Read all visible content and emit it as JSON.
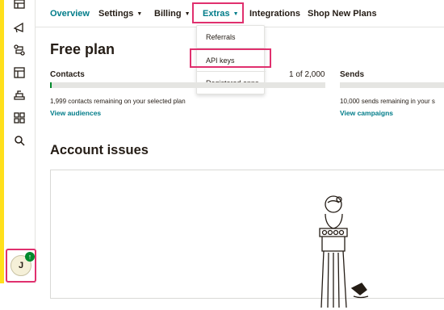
{
  "sidebar": {
    "icons": [
      "campaigns-icon",
      "megaphone-icon",
      "automations-icon",
      "website-icon",
      "content-icon",
      "integrations-icon",
      "search-icon"
    ],
    "avatar": {
      "initial": "J",
      "badge": "↑"
    }
  },
  "nav": {
    "overview": "Overview",
    "settings": "Settings",
    "billing": "Billing",
    "extras": "Extras",
    "integrations": "Integrations",
    "shop": "Shop New Plans"
  },
  "extras_menu": {
    "items": [
      "Referrals",
      "API keys",
      "Registered apps"
    ]
  },
  "plan": {
    "title": "Free plan",
    "contacts_label": "Contacts",
    "contacts_count": "1 of 2,000",
    "contacts_progress": 0.0005,
    "contacts_remaining": "1,999 contacts remaining on your selected plan",
    "contacts_link": "View audiences",
    "sends_label": "Sends",
    "sends_remaining": "10,000 sends remaining in your s",
    "sends_link": "View campaigns"
  },
  "issues": {
    "title": "Account issues"
  },
  "colors": {
    "accent": "#007c89",
    "highlight": "#e0306e",
    "brand_yellow": "#ffe01b",
    "success": "#00892c"
  }
}
